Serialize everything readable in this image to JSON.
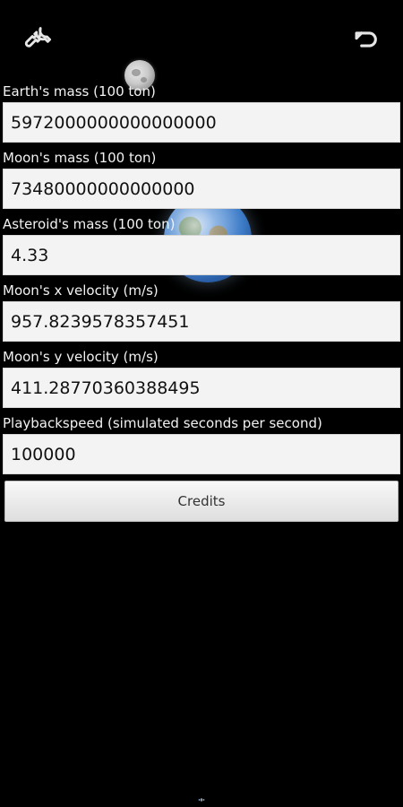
{
  "toolbar": {
    "left_icon": "wrench-icon",
    "right_icon": "undo-icon"
  },
  "fields": [
    {
      "label": "Earth's mass (100 ton)",
      "value": "5972000000000000000"
    },
    {
      "label": "Moon's mass (100 ton)",
      "value": "73480000000000000"
    },
    {
      "label": "Asteroid's mass (100 ton)",
      "value": "4.33"
    },
    {
      "label": "Moon's  x velocity (m/s)",
      "value": "957.8239578357451"
    },
    {
      "label": "Moon's y velocity (m/s)",
      "value": "411.28770360388495"
    },
    {
      "label": "Playbackspeed (simulated seconds per second)",
      "value": "100000"
    }
  ],
  "actions": {
    "credits_label": "Credits"
  },
  "colors": {
    "background": "#000000",
    "field_bg": "#f3f3f3",
    "field_border": "#d7d7d7",
    "button_bg": "#e6e6e6"
  }
}
